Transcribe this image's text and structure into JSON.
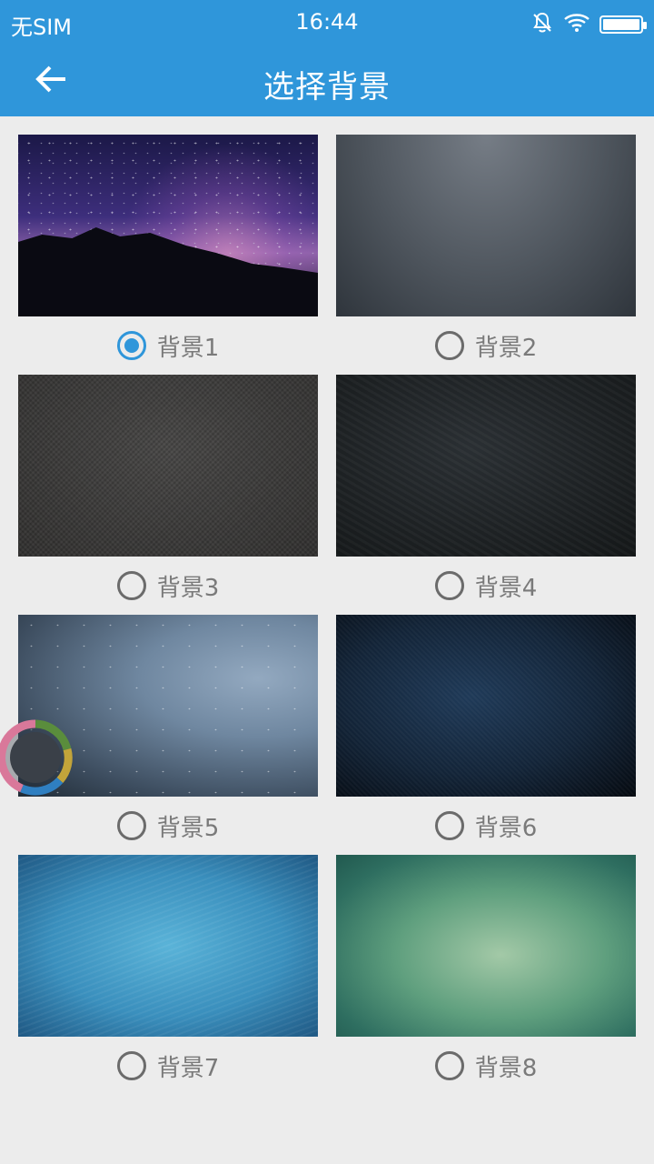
{
  "status_bar": {
    "carrier": "无SIM",
    "time": "16:44"
  },
  "header": {
    "title": "选择背景"
  },
  "colors": {
    "accent": "#2f96da",
    "background": "#ececec",
    "radio_off": "#6b6b6b",
    "label": "#7a7a7a"
  },
  "backgrounds": [
    {
      "label": "背景1",
      "selected": true
    },
    {
      "label": "背景2",
      "selected": false
    },
    {
      "label": "背景3",
      "selected": false
    },
    {
      "label": "背景4",
      "selected": false
    },
    {
      "label": "背景5",
      "selected": false
    },
    {
      "label": "背景6",
      "selected": false
    },
    {
      "label": "背景7",
      "selected": false
    },
    {
      "label": "背景8",
      "selected": false
    }
  ],
  "icons": {
    "back": "arrow-left-icon",
    "mute": "bell-off-icon",
    "wifi": "wifi-icon",
    "battery": "battery-icon",
    "floating": "floating-assistant-icon"
  }
}
